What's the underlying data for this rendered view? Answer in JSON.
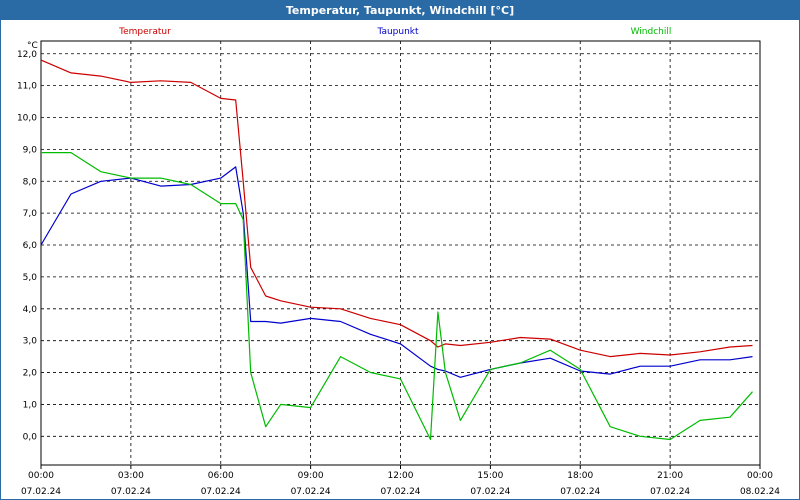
{
  "window": {
    "title": "Temperatur, Taupunkt, Windchill [°C]"
  },
  "chart_data": {
    "type": "line",
    "title": "Temperatur, Taupunkt, Windchill [°C]",
    "ylabel": "°C",
    "ylim": [
      -0.9,
      12.4
    ],
    "xlim": [
      "2024-02-07 00:00",
      "2024-02-08 00:00"
    ],
    "grid": true,
    "yticks": [
      "0,0",
      "1,0",
      "2,0",
      "3,0",
      "4,0",
      "5,0",
      "6,0",
      "7,0",
      "8,0",
      "9,0",
      "10,0",
      "11,0",
      "12,0"
    ],
    "xticks": [
      {
        "time": "00:00",
        "date": "07.02.24"
      },
      {
        "time": "03:00",
        "date": "07.02.24"
      },
      {
        "time": "06:00",
        "date": "07.02.24"
      },
      {
        "time": "09:00",
        "date": "07.02.24"
      },
      {
        "time": "12:00",
        "date": "07.02.24"
      },
      {
        "time": "15:00",
        "date": "07.02.24"
      },
      {
        "time": "18:00",
        "date": "07.02.24"
      },
      {
        "time": "21:00",
        "date": "07.02.24"
      },
      {
        "time": "00:00",
        "date": "08.02.24"
      }
    ],
    "x": [
      "00:00",
      "01:00",
      "02:00",
      "03:00",
      "04:00",
      "05:00",
      "06:00",
      "06:30",
      "06:45",
      "07:00",
      "07:30",
      "08:00",
      "09:00",
      "10:00",
      "11:00",
      "12:00",
      "13:00",
      "13:15",
      "13:30",
      "14:00",
      "15:00",
      "16:00",
      "17:00",
      "18:00",
      "19:00",
      "20:00",
      "21:00",
      "22:00",
      "23:00",
      "23:45"
    ],
    "series": [
      {
        "name": "Temperatur",
        "color": "#cc0000",
        "values": [
          11.8,
          11.4,
          11.3,
          11.1,
          11.15,
          11.1,
          10.6,
          10.55,
          8.0,
          5.3,
          4.4,
          4.25,
          4.05,
          4.0,
          3.7,
          3.5,
          3.0,
          2.8,
          2.9,
          2.85,
          2.95,
          3.1,
          3.05,
          2.7,
          2.5,
          2.6,
          2.55,
          2.65,
          2.8,
          2.85
        ]
      },
      {
        "name": "Taupunkt",
        "color": "#0000cc",
        "values": [
          6.0,
          7.6,
          8.0,
          8.1,
          7.85,
          7.9,
          8.1,
          8.45,
          7.0,
          3.6,
          3.6,
          3.55,
          3.7,
          3.6,
          3.2,
          2.9,
          2.2,
          2.1,
          2.05,
          1.85,
          2.1,
          2.3,
          2.45,
          2.05,
          1.95,
          2.2,
          2.2,
          2.4,
          2.4,
          2.5
        ]
      },
      {
        "name": "Windchill",
        "color": "#00bb00",
        "values": [
          8.9,
          8.9,
          8.3,
          8.1,
          8.1,
          7.9,
          7.3,
          7.3,
          6.8,
          2.0,
          0.3,
          1.0,
          0.9,
          2.5,
          2.0,
          1.8,
          -0.1,
          3.9,
          2.0,
          0.5,
          2.1,
          2.3,
          2.7,
          2.1,
          0.3,
          0.0,
          -0.1,
          0.5,
          0.6,
          1.4
        ]
      }
    ]
  }
}
